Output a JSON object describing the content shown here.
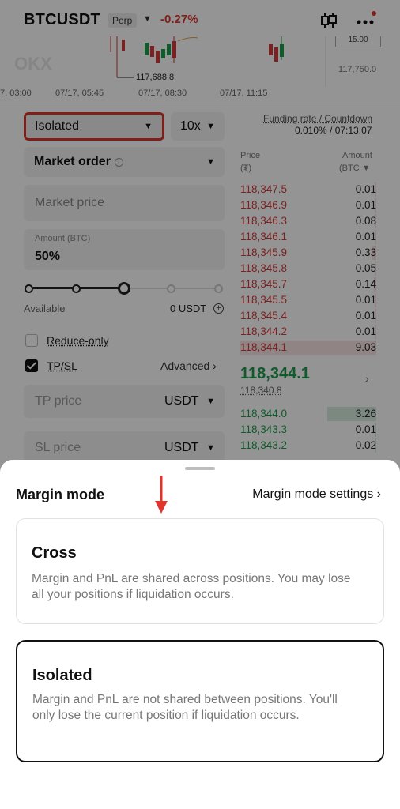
{
  "header": {
    "pair": "BTCUSDT",
    "badge": "Perp",
    "change": "-0.27%"
  },
  "chart": {
    "low_label": "117,688.8",
    "right_price": "117,750.0",
    "top_box": "15.00",
    "times": [
      "7, 03:00",
      "07/17, 05:45",
      "07/17, 08:30",
      "07/17, 11:15"
    ]
  },
  "form": {
    "margin_mode": "Isolated",
    "leverage": "10x",
    "funding_label": "Funding rate / Countdown",
    "funding_value": "0.010% / 07:13:07",
    "order_type": "Market order",
    "market_price": "Market price",
    "amount_label": "Amount (BTC)",
    "amount_value": "50%",
    "slider_percent": 50,
    "available_label": "Available",
    "available_value": "0 USDT",
    "reduce_only": "Reduce-only",
    "tpsl": "TP/SL",
    "advanced": "Advanced",
    "tp_price": "TP price",
    "sl_price": "SL price",
    "unit": "USDT"
  },
  "orderbook": {
    "price_header": "Price",
    "price_unit": "(₮)",
    "amount_header": "Amount",
    "amount_unit": "(BTC",
    "asks": [
      {
        "price": "118,347.5",
        "amount": "0.01"
      },
      {
        "price": "118,346.9",
        "amount": "0.01"
      },
      {
        "price": "118,346.3",
        "amount": "0.08"
      },
      {
        "price": "118,346.1",
        "amount": "0.01"
      },
      {
        "price": "118,345.9",
        "amount": "0.33"
      },
      {
        "price": "118,345.8",
        "amount": "0.05"
      },
      {
        "price": "118,345.7",
        "amount": "0.14"
      },
      {
        "price": "118,345.5",
        "amount": "0.01"
      },
      {
        "price": "118,345.4",
        "amount": "0.01"
      },
      {
        "price": "118,344.2",
        "amount": "0.01"
      },
      {
        "price": "118,344.1",
        "amount": "9.03"
      }
    ],
    "mid_price": "118,344.1",
    "mark_price": "118,340.8",
    "bids": [
      {
        "price": "118,344.0",
        "amount": "3.26"
      },
      {
        "price": "118,343.3",
        "amount": "0.01"
      },
      {
        "price": "118,343.2",
        "amount": "0.02"
      }
    ]
  },
  "sheet": {
    "title": "Margin mode",
    "settings_link": "Margin mode settings",
    "options": [
      {
        "title": "Cross",
        "description": "Margin and PnL are shared across positions. You may lose all your positions if liquidation occurs."
      },
      {
        "title": "Isolated",
        "description": "Margin and PnL are not shared between positions. You'll only lose the current position if liquidation occurs."
      }
    ],
    "selected": "Isolated"
  },
  "colors": {
    "ask": "#d23a3a",
    "bid": "#1e9d4a",
    "highlight": "#e0342c"
  }
}
